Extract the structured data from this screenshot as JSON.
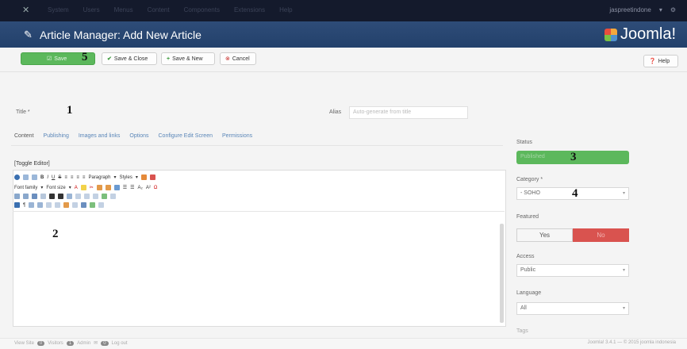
{
  "topbar": {
    "logo_glyph": "✕",
    "menu": [
      "System",
      "Users",
      "Menus",
      "Content",
      "Components",
      "Extensions",
      "Help"
    ],
    "user": "jaspreetindone",
    "user_caret": "▾",
    "gear": "⚙"
  },
  "titlebar": {
    "title": "Article Manager: Add New Article",
    "brand": "Joomla!"
  },
  "toolbar": {
    "save": "Save",
    "save_close": "Save & Close",
    "save_new": "Save & New",
    "cancel": "Cancel",
    "help": "Help"
  },
  "markers": [
    "1",
    "2",
    "3",
    "4",
    "5"
  ],
  "form": {
    "title_label": "Title *",
    "title_value": "",
    "alias_label": "Alias",
    "alias_placeholder": "Auto-generate from title"
  },
  "tabs": [
    "Content",
    "Publishing",
    "Images and links",
    "Options",
    "Configure Edit Screen",
    "Permissions"
  ],
  "editor": {
    "toggle": "[Toggle Editor]",
    "paragraph": "Paragraph",
    "styles": "Styles",
    "font_family": "Font family",
    "font_size": "Font size",
    "content": ""
  },
  "side": {
    "status_label": "Status",
    "status_value": "Published",
    "category_label": "Category *",
    "category_value": "- SOHO",
    "featured_label": "Featured",
    "featured_yes": "Yes",
    "featured_no": "No",
    "access_label": "Access",
    "access_value": "Public",
    "language_label": "Language",
    "language_value": "All",
    "tags_label": "Tags"
  },
  "footer": {
    "view_site": "View Site",
    "visitors_count": "0",
    "visitors": "Visitors",
    "admin_count": "1",
    "admin": "Admin",
    "messages_count": "0",
    "logout": "Log out",
    "version": "Joomla! 3.4.1 — © 2015 joomla indonesia"
  },
  "colors": {
    "topbar": "#141a2c",
    "titlebar": "#2e4c78",
    "save_green": "#5cb85c",
    "no_red": "#d9534f"
  }
}
